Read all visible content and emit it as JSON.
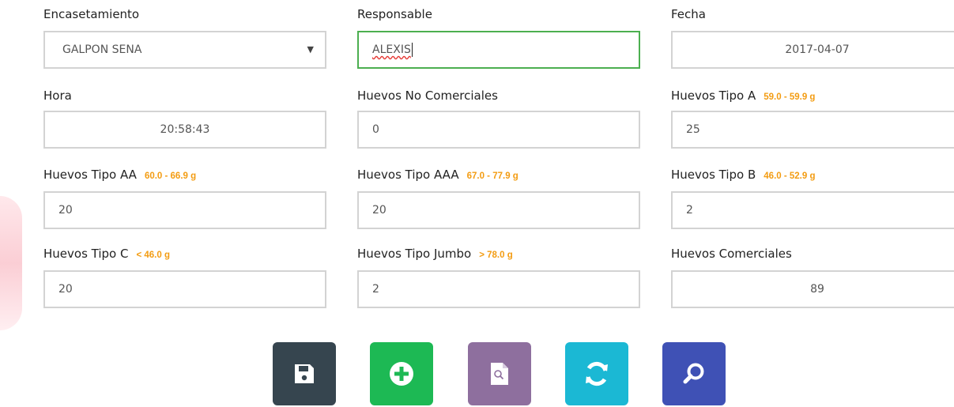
{
  "form": {
    "encasetamiento": {
      "label": "Encasetamiento",
      "value": "GALPON SENA"
    },
    "responsable": {
      "label": "Responsable",
      "value": "ALEXIS"
    },
    "fecha": {
      "label": "Fecha",
      "value": "2017-04-07"
    },
    "hora": {
      "label": "Hora",
      "value": "20:58:43"
    },
    "no_comerciales": {
      "label": "Huevos No Comerciales",
      "value": "0"
    },
    "tipo_a": {
      "label": "Huevos Tipo A",
      "range": "59.0 - 59.9 g",
      "value": "25"
    },
    "tipo_aa": {
      "label": "Huevos Tipo AA",
      "range": "60.0 - 66.9 g",
      "value": "20"
    },
    "tipo_aaa": {
      "label": "Huevos Tipo AAA",
      "range": "67.0 - 77.9 g",
      "value": "20"
    },
    "tipo_b": {
      "label": "Huevos Tipo B",
      "range": "46.0 - 52.9 g",
      "value": "2"
    },
    "tipo_c": {
      "label": "Huevos Tipo C",
      "range": "< 46.0 g",
      "value": "20"
    },
    "tipo_jumbo": {
      "label": "Huevos Tipo Jumbo",
      "range": "> 78.0 g",
      "value": "2"
    },
    "comerciales": {
      "label": "Huevos Comerciales",
      "value": "89"
    }
  },
  "buttons": [
    {
      "icon": "floppy-disk-icon",
      "color": "#36454f"
    },
    {
      "icon": "plus-circle-icon",
      "color": "#1db954"
    },
    {
      "icon": "document-search-icon",
      "color": "#8e6f9e"
    },
    {
      "icon": "refresh-icon",
      "color": "#1bb8d4"
    },
    {
      "icon": "magnifier-icon",
      "color": "#3f51b5"
    }
  ],
  "colors": {
    "range_text": "#f39c12",
    "active_border": "#4caf50",
    "input_border": "#d3d3d3"
  }
}
